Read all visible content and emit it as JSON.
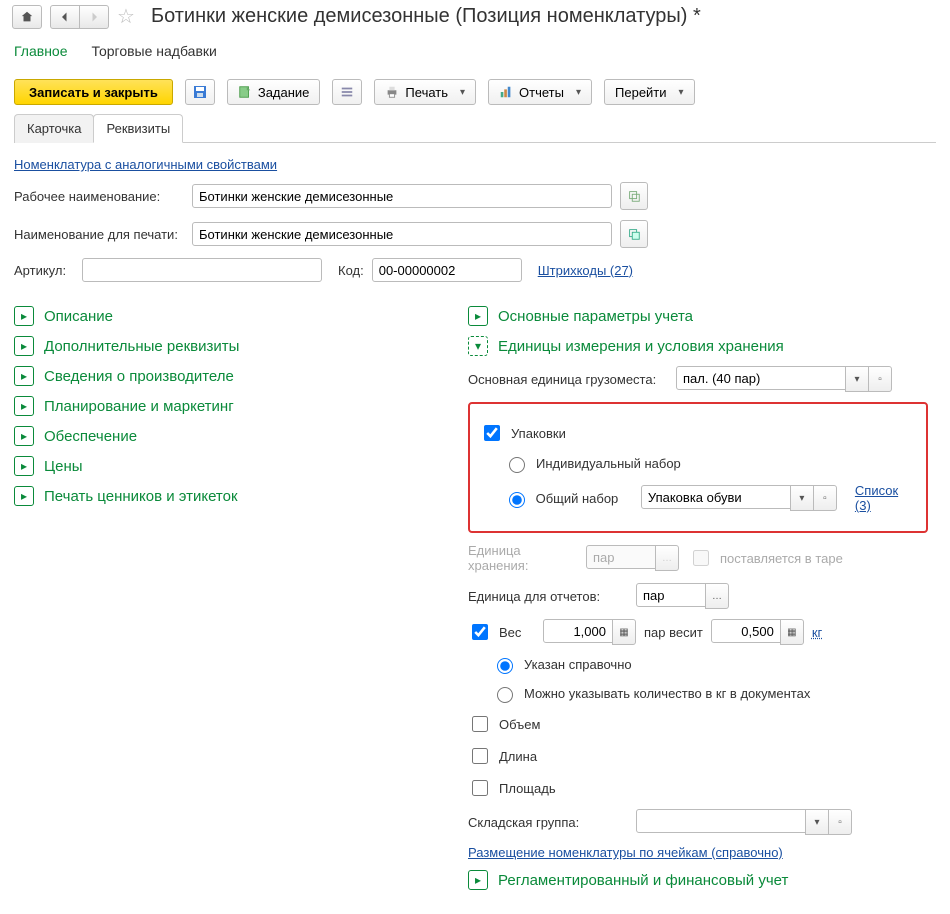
{
  "title": "Ботинки женские демисезонные (Позиция номенклатуры) *",
  "sectionTabs": {
    "main": "Главное",
    "markups": "Торговые надбавки"
  },
  "cmd": {
    "writeClose": "Записать и закрыть",
    "task": "Задание",
    "print": "Печать",
    "reports": "Отчеты",
    "goto": "Перейти"
  },
  "tabs": {
    "card": "Карточка",
    "props": "Реквизиты"
  },
  "links": {
    "analog": "Номенклатура с аналогичными свойствами",
    "barcodes": "Штрихкоды (27)",
    "list": "Список (3)",
    "cells": "Размещение номенклатуры по ячейкам (справочно)"
  },
  "labels": {
    "workName": "Рабочее наименование:",
    "printName": "Наименование для печати:",
    "article": "Артикул:",
    "code": "Код:",
    "mainCargoUnit": "Основная единица грузоместа:",
    "packs": "Упаковки",
    "individualSet": "Индивидуальный набор",
    "commonSet": "Общий набор",
    "storeUnit": "Единица хранения:",
    "inContainer": "поставляется в таре",
    "reportsUnit": "Единица для отчетов:",
    "weight": "Вес",
    "pairWeighs": "пар весит",
    "kg": "кг",
    "refOnly": "Указан справочно",
    "qtyKgDocs": "Можно указывать количество в кг в документах",
    "volume": "Объем",
    "length": "Длина",
    "area": "Площадь",
    "warehouseGroup": "Складская группа:"
  },
  "values": {
    "workName": "Ботинки женские демисезонные",
    "printName": "Ботинки женские демисезонные",
    "article": "",
    "code": "00-00000002",
    "cargoUnit": "пал. (40 пар)",
    "commonSet": "Упаковка обуви",
    "storeUnit": "пар",
    "reportsUnit": "пар",
    "weightQty": "1,000",
    "weight": "0,500",
    "warehouseGroup": ""
  },
  "expanders": {
    "left": [
      "Описание",
      "Дополнительные реквизиты",
      "Сведения о производителе",
      "Планирование и маркетинг",
      "Обеспечение",
      "Цены",
      "Печать ценников и этикеток"
    ],
    "right": {
      "basicParams": "Основные параметры учета",
      "units": "Единицы измерения и условия хранения",
      "regulated": "Регламентированный и финансовый учет"
    }
  }
}
